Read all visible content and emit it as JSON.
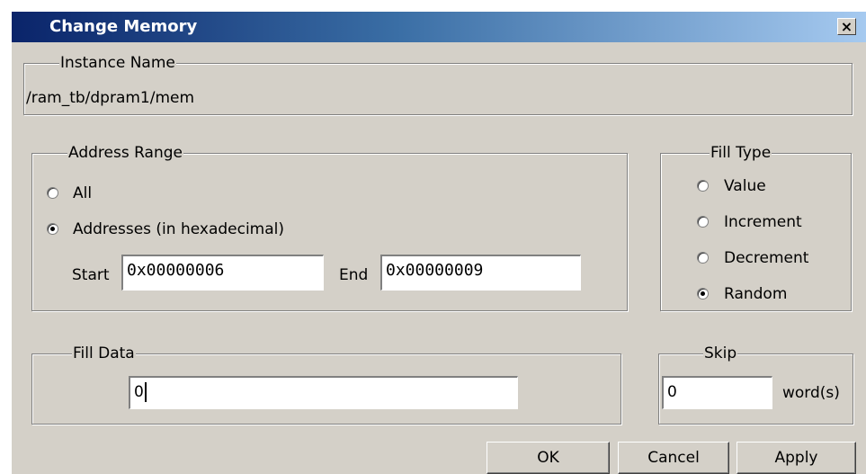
{
  "dialog": {
    "title": "Change Memory",
    "close_label": "×"
  },
  "instance": {
    "legend": "Instance Name",
    "value": "/ram_tb/dpram1/mem"
  },
  "address_range": {
    "legend": "Address Range",
    "all_label": "All",
    "all_selected": false,
    "addresses_label": "Addresses (in hexadecimal)",
    "addresses_selected": true,
    "start_label": "Start",
    "start_value": "0x00000006",
    "end_label": "End",
    "end_value": "0x00000009"
  },
  "fill_type": {
    "legend": "Fill Type",
    "options": [
      {
        "label": "Value",
        "selected": false
      },
      {
        "label": "Increment",
        "selected": false
      },
      {
        "label": "Decrement",
        "selected": false
      },
      {
        "label": "Random",
        "selected": true
      }
    ]
  },
  "fill_data": {
    "legend": "Fill Data",
    "value": "0"
  },
  "skip": {
    "legend": "Skip",
    "value": "0",
    "unit": "word(s)"
  },
  "buttons": {
    "ok": "OK",
    "cancel": "Cancel",
    "apply": "Apply"
  }
}
